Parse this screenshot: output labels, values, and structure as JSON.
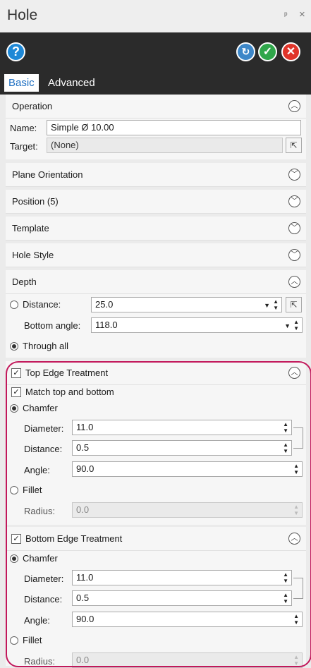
{
  "window": {
    "title": "Hole",
    "pin_glyph": "ᵖ",
    "close_glyph": "×"
  },
  "toolbar": {
    "help_icon": "?",
    "apply_icon": "↻",
    "ok_icon": "✓",
    "cancel_icon": "✕"
  },
  "tabs": [
    {
      "label": "Basic",
      "active": true
    },
    {
      "label": "Advanced",
      "active": false
    }
  ],
  "operation": {
    "title": "Operation",
    "name_label": "Name:",
    "name_value": "Simple Ø 10.00",
    "target_label": "Target:",
    "target_value": "(None)"
  },
  "collapsed_sections": [
    "Plane Orientation",
    "Position (5)",
    "Template",
    "Hole Style"
  ],
  "depth": {
    "title": "Depth",
    "distance_label": "Distance:",
    "distance_value": "25.0",
    "bottom_angle_label": "Bottom angle:",
    "bottom_angle_value": "118.0",
    "through_all_label": "Through all"
  },
  "top_edge": {
    "title": "Top Edge Treatment",
    "match_label": "Match top and bottom",
    "chamfer_label": "Chamfer",
    "diameter_label": "Diameter:",
    "diameter_value": "11.0",
    "distance_label": "Distance:",
    "distance_value": "0.5",
    "angle_label": "Angle:",
    "angle_value": "90.0",
    "fillet_label": "Fillet",
    "radius_label": "Radius:",
    "radius_value": "0.0"
  },
  "bottom_edge": {
    "title": "Bottom Edge Treatment",
    "chamfer_label": "Chamfer",
    "diameter_label": "Diameter:",
    "diameter_value": "11.0",
    "distance_label": "Distance:",
    "distance_value": "0.5",
    "angle_label": "Angle:",
    "angle_value": "90.0",
    "fillet_label": "Fillet",
    "radius_label": "Radius:",
    "radius_value": "0.0"
  },
  "colors": {
    "toolbar_bg": "#2b2b2b",
    "highlight_ring": "#c2185b",
    "tab_active": "#1e6fc2"
  }
}
